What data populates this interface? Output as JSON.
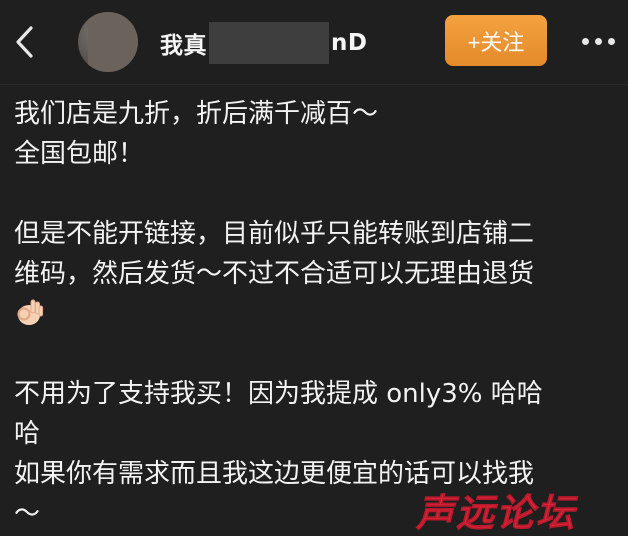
{
  "header": {
    "username_prefix": "我真",
    "username_suffix": "nD",
    "follow_label": "+关注"
  },
  "post": {
    "lines": [
      "我们店是九折，折后满千减百～",
      "全国包邮！",
      "",
      "但是不能开链接，目前似乎只能转账到店铺二",
      "维码，然后发货～不过不合适可以无理由退货",
      "",
      "",
      "不用为了支持我买！因为我提成 only3% 哈哈",
      "哈",
      "如果你有需求而且我这边更便宜的话可以找我",
      "～"
    ],
    "emoji": "ok-hand-emoji"
  },
  "watermark": {
    "text": "声远论坛"
  },
  "colors": {
    "background": "#1f1f1f",
    "text": "#f3f3f3",
    "follow_button": "#ee9633",
    "watermark": "#e0253b"
  }
}
